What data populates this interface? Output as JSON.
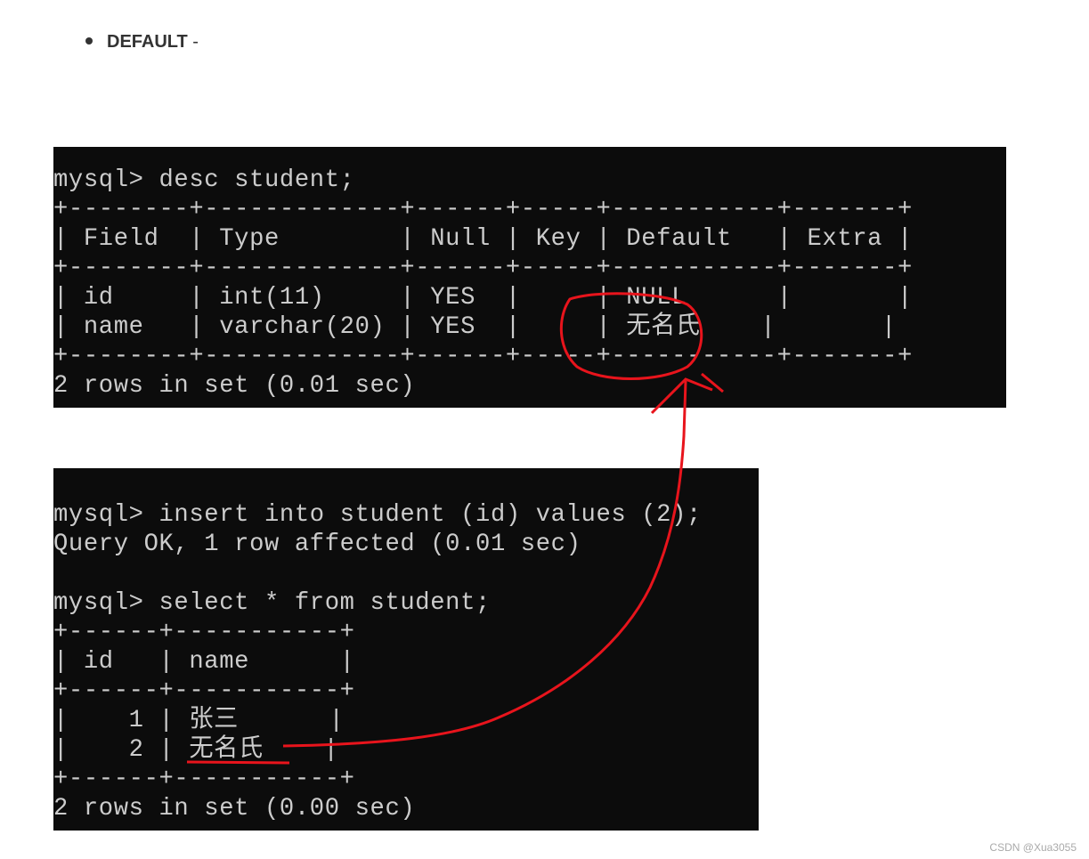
{
  "bullet": {
    "term": "DEFAULT",
    "suffix": " -"
  },
  "terminal_1": {
    "lines": [
      "mysql> desc student;",
      "+--------+-------------+------+-----+-----------+-------+",
      "| Field  | Type        | Null | Key | Default   | Extra |",
      "+--------+-------------+------+-----+-----------+-------+",
      "| id     | int(11)     | YES  |     | NULL      |       |",
      "| name   | varchar(20) | YES  |     | 无名氏    |       |",
      "+--------+-------------+------+-----+-----------+-------+",
      "2 rows in set (0.01 sec)"
    ]
  },
  "terminal_2": {
    "lines": [
      "mysql> insert into student (id) values (2);",
      "Query OK, 1 row affected (0.01 sec)",
      "",
      "mysql> select * from student;",
      "+------+-----------+",
      "| id   | name      |",
      "+------+-----------+",
      "|    1 | 张三      |",
      "|    2 | 无名氏    |",
      "+------+-----------+",
      "2 rows in set (0.00 sec)"
    ]
  },
  "annotation_color": "#e8141c",
  "watermark": "CSDN @Xua3055"
}
